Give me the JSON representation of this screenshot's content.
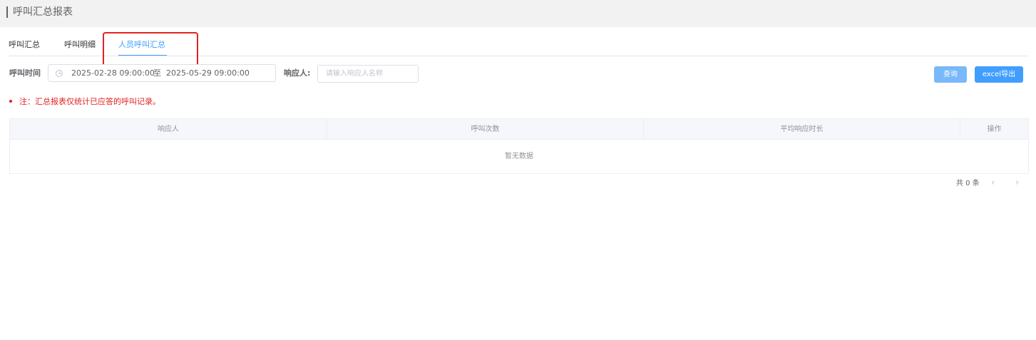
{
  "page": {
    "title": "呼叫汇总报表"
  },
  "tabs": [
    {
      "label": "呼叫汇总",
      "active": false
    },
    {
      "label": "呼叫明细",
      "active": false
    },
    {
      "label": "人员呼叫汇总",
      "active": true
    }
  ],
  "filters": {
    "call_time_label": "呼叫时间",
    "start_date": "2025-02-28 09:00:00",
    "range_separator": "至",
    "end_date": "2025-05-29 09:00:00",
    "responder_label": "响应人:",
    "responder_placeholder": "请输入响应人名称",
    "responder_value": ""
  },
  "actions": {
    "query_label": "查询",
    "export_label": "excel导出"
  },
  "note": "注：汇总报表仅统计已应答的呼叫记录。",
  "table": {
    "columns": [
      "响应人",
      "呼叫次数",
      "平均响应时长",
      "操作"
    ],
    "rows": [],
    "empty_text": "暂无数据"
  },
  "pagination": {
    "total_text": "共 0 条",
    "prev_icon": "chevron-left-icon",
    "next_icon": "chevron-right-icon"
  },
  "colors": {
    "accent": "#409eff",
    "highlight": "#e32121",
    "note": "#e32121"
  }
}
